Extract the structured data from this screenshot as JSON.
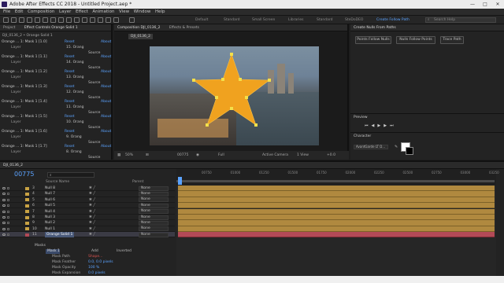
{
  "titlebar": {
    "title": "Adobe After Effects CC 2018 - Untitled Project.aep *",
    "minimize": "—",
    "maximize": "□",
    "close": "✕"
  },
  "menu": [
    "File",
    "Edit",
    "Composition",
    "Layer",
    "Effect",
    "Animation",
    "View",
    "Window",
    "Help"
  ],
  "workspaces": [
    "Default",
    "Standard",
    "Small Screen",
    "Libraries",
    "Standard",
    "SteDoDEO",
    "Create Follow Path"
  ],
  "active_workspace_index": 6,
  "search_help": {
    "placeholder": "Search Help"
  },
  "left_panel": {
    "tabs": [
      "Project",
      "Effect Controls Orange Solid 1"
    ],
    "subtitle": "DJI_0136_2 • Orange Solid 1",
    "reset_label": "Reset",
    "about_label": "About",
    "layer_label": "Layer",
    "rows": [
      {
        "label": "Orange ...  1: Mask 1 [1.0]",
        "layer_val": "15. Orang",
        "source": "Source"
      },
      {
        "label": "Orange ...  1: Mask 1 [1.1]",
        "layer_val": "14. Orang",
        "source": "Source"
      },
      {
        "label": "Orange ...  1: Mask 1 [1.2]",
        "layer_val": "13. Orang",
        "source": "Source"
      },
      {
        "label": "Orange ...  1: Mask 1 [1.3]",
        "layer_val": "12. Orang",
        "source": "Source"
      },
      {
        "label": "Orange ...  1: Mask 1 [1.4]",
        "layer_val": "11. Orang",
        "source": "Source"
      },
      {
        "label": "Orange ...  1: Mask 1 [1.5]",
        "layer_val": "10. Orang",
        "source": "Source"
      },
      {
        "label": "Orange ...  1: Mask 1 [1.6]",
        "layer_val": "9. Orang",
        "source": "Source"
      },
      {
        "label": "Orange ...  1: Mask 1 [1.7]",
        "layer_val": "8. Orang",
        "source": "Source"
      }
    ]
  },
  "comp_panel": {
    "tabs": [
      "Composition DJI_0136_2",
      "Effects & Presets"
    ],
    "comp_tab": "DJI_0136_2",
    "footer": {
      "zoom": "50%",
      "timecode": "00775",
      "res": "Full",
      "camera": "Active Camera",
      "view": "1 View",
      "offset": "+0.0"
    }
  },
  "right_panel": {
    "title": "Create Nulls From Paths",
    "buttons": [
      "Points Follow Nulls",
      "Nulls Follow Points",
      "Trace Path"
    ],
    "preview_title": "Preview",
    "character_title": "Character",
    "font_name": "AvantGarde LT D..."
  },
  "timeline": {
    "tab": "DJI_0136_2",
    "timecode": "00775",
    "search_placeholder": "",
    "col_source": "Source Name",
    "col_parent": "Parent",
    "ruler": [
      "00775",
      "00750",
      "01000",
      "01250",
      "01500",
      "01750",
      "02000",
      "02250",
      "02500",
      "02750",
      "03000",
      "03250"
    ],
    "layers": [
      {
        "num": "3",
        "name": "Null 8",
        "parent": "None"
      },
      {
        "num": "4",
        "name": "Null 7",
        "parent": "None"
      },
      {
        "num": "5",
        "name": "Null 6",
        "parent": "None"
      },
      {
        "num": "6",
        "name": "Null 5",
        "parent": "None"
      },
      {
        "num": "7",
        "name": "Null 4",
        "parent": "None"
      },
      {
        "num": "8",
        "name": "Null 3",
        "parent": "None"
      },
      {
        "num": "9",
        "name": "Null 2",
        "parent": "None"
      },
      {
        "num": "10",
        "name": "Null 1",
        "parent": "None"
      },
      {
        "num": "11",
        "name": "Orange Solid 1",
        "parent": "None"
      }
    ],
    "masks_label": "Masks",
    "mask1_label": "Mask 1",
    "mask_mode": "Add",
    "inverted_label": "Inverted",
    "mask_path_label": "Mask Path",
    "mask_path_value": "Shape...",
    "mask_feather_label": "Mask Feather",
    "mask_feather_value": "0.0, 0.0 pixels",
    "mask_opacity_label": "Mask Opacity",
    "mask_opacity_value": "100 %",
    "mask_expansion_label": "Mask Expansion",
    "mask_expansion_value": "0.0 pixels",
    "footer_toggle": "Toggle Switches / Modes"
  },
  "colors": {
    "accent": "#5ba3ff",
    "layer_bar": "#b0893f",
    "selected_bar": "#b34a57",
    "star": "#f0a21f"
  }
}
